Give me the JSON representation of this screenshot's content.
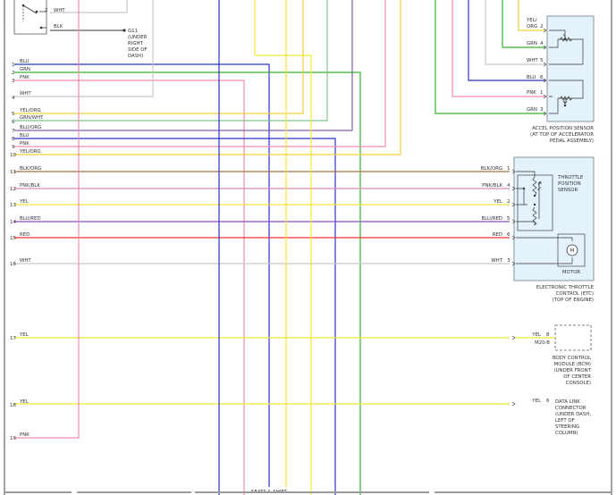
{
  "colors": {
    "BLU": "#2b33c4",
    "GRN": "#33b233",
    "PNK": "#f08cb4",
    "WHT": "#c8c8c8",
    "YEL": "#f2e533",
    "GRNWHT": "#7fc78a",
    "BLUORG": "#8060a8",
    "YELORG": "#f0cf3a",
    "BLKORG": "#a87040",
    "PNKBLK": "#d88ab6",
    "BLURED": "#8c4ec0",
    "RED": "#ee3333",
    "BLK": "#333333"
  },
  "top_labels": {
    "pin2": "2",
    "wht": "WHT",
    "blk": "BLK",
    "g11": "G11",
    "under": "(UNDER",
    "right": "RIGHT",
    "side_of": "SIDE OF",
    "dash": "DASH)"
  },
  "left_pins": [
    {
      "pin": "1",
      "wire": "BLU"
    },
    {
      "pin": "2",
      "wire": "GRN"
    },
    {
      "pin": "3",
      "wire": "PNK"
    },
    {
      "pin": "4",
      "wire": "WHT"
    },
    {
      "pin": "5",
      "wire": "YEL/ORG"
    },
    {
      "pin": "6",
      "wire": "GRN/WHT"
    },
    {
      "pin": "7",
      "wire": "BLU/ORG"
    },
    {
      "pin": "8",
      "wire": "BLU"
    },
    {
      "pin": "9",
      "wire": "PNK"
    },
    {
      "pin": "10",
      "wire": "YEL/ORG"
    },
    {
      "pin": "11",
      "wire": "BLK/ORG"
    },
    {
      "pin": "12",
      "wire": "PNK/BLK"
    },
    {
      "pin": "13",
      "wire": "YEL"
    },
    {
      "pin": "14",
      "wire": "BLU/RED"
    },
    {
      "pin": "15",
      "wire": "RED"
    },
    {
      "pin": "16",
      "wire": "WHT"
    },
    {
      "pin": "17",
      "wire": "YEL"
    },
    {
      "pin": "18",
      "wire": "YEL"
    },
    {
      "pin": "19",
      "wire": "PNK"
    }
  ],
  "accel_sensor": {
    "pins": [
      {
        "wire1": "YEL/",
        "wire2": "ORG",
        "pin": "2"
      },
      {
        "wire1": "GRN",
        "pin": "4"
      },
      {
        "wire1": "WHT",
        "pin": "5"
      },
      {
        "wire1": "BLU",
        "pin": "6"
      },
      {
        "wire1": "PNK",
        "pin": "1"
      },
      {
        "wire1": "GRN",
        "pin": "3"
      }
    ],
    "caption": [
      "ACCEL POSITION SENSOR",
      "(AT TOP OF ACCELERATOR",
      "PEDAL ASSEMBLY)"
    ]
  },
  "etc": {
    "pins": [
      {
        "wire": "BLK/ORG",
        "pin": "1"
      },
      {
        "wire": "PNK/BLK",
        "pin": "4"
      },
      {
        "wire": "YEL",
        "pin": "2"
      },
      {
        "wire": "BLU/RED",
        "pin": "5"
      },
      {
        "wire": "RED",
        "pin": "6"
      },
      {
        "wire": "WHT",
        "pin": "3"
      }
    ],
    "tps": [
      "THROTTLE",
      "POSITION",
      "SENSOR"
    ],
    "motor_symbol": "M",
    "motor_label": "MOTOR",
    "caption": [
      "ELECTRONIC THROTTLE",
      "CONTROL (ETC)",
      "(TOP OF ENGINE)"
    ]
  },
  "bcm": {
    "wire": "YEL",
    "pin": "8",
    "connector": "M20-B",
    "caption": [
      "BODY CONTROL",
      "MODULE (BCM)",
      "(UNDER FRONT",
      "OF CENTER",
      "CONSOLE)"
    ]
  },
  "dlc": {
    "wire": "YEL",
    "pin": "6",
    "caption": [
      "DATA LINK",
      "CONNECTOR",
      "(UNDER DASH,",
      "LEFT OF",
      "STEERING",
      "COLUMN)"
    ]
  },
  "bottom_text": "SEATS & SHIFT"
}
